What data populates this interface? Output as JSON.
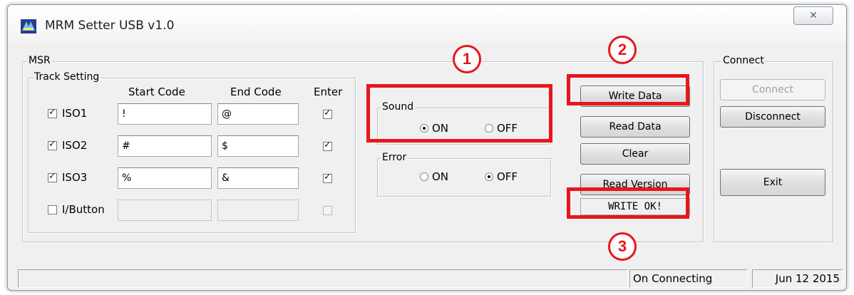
{
  "window": {
    "title": "MRM Setter USB v1.0",
    "close_glyph": "✕"
  },
  "msr": {
    "legend": "MSR",
    "track_setting": {
      "legend": "Track Setting",
      "headers": {
        "start": "Start Code",
        "end": "End Code",
        "enter": "Enter"
      },
      "rows": [
        {
          "label": "ISO1",
          "checked": true,
          "start": "!",
          "end": "@",
          "enter": true,
          "enabled": true
        },
        {
          "label": "ISO2",
          "checked": true,
          "start": "#",
          "end": "$",
          "enter": true,
          "enabled": true
        },
        {
          "label": "ISO3",
          "checked": true,
          "start": "%",
          "end": "&",
          "enter": true,
          "enabled": true
        },
        {
          "label": "I/Button",
          "checked": false,
          "start": "",
          "end": "",
          "enter": false,
          "enabled": false
        }
      ]
    },
    "sound": {
      "legend": "Sound",
      "on_label": "ON",
      "off_label": "OFF",
      "selected": "ON"
    },
    "error": {
      "legend": "Error",
      "on_label": "ON",
      "off_label": "OFF",
      "selected": "OFF"
    },
    "buttons": {
      "write": "Write Data",
      "read": "Read Data",
      "clear": "Clear",
      "read_version": "Read Version"
    },
    "status_text": "WRITE OK!"
  },
  "connect": {
    "legend": "Connect",
    "connect_label": "Connect",
    "disconnect_label": "Disconnect",
    "exit_label": "Exit"
  },
  "statusbar": {
    "connection": "On Connecting",
    "date": "Jun 12 2015"
  },
  "annotations": {
    "marker1": "1",
    "marker2": "2",
    "marker3": "3",
    "color": "#e8161a"
  }
}
